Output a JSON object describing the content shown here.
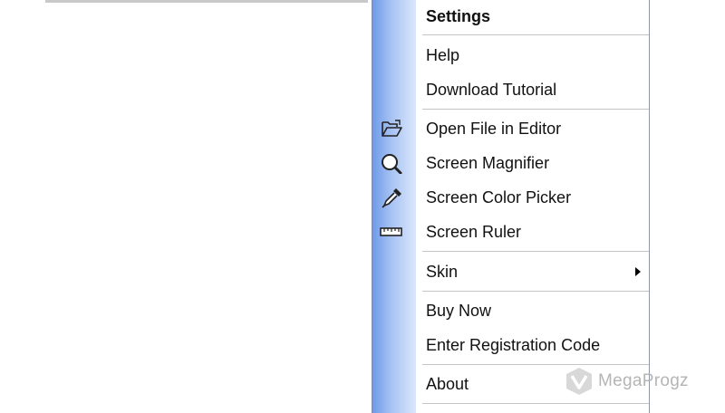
{
  "menu": {
    "items": [
      {
        "label": "Settings",
        "icon": null,
        "bold": true
      },
      {
        "label": "Help",
        "icon": null
      },
      {
        "label": "Download Tutorial",
        "icon": null
      },
      {
        "label": "Open File in Editor",
        "icon": "open-folder-icon"
      },
      {
        "label": "Screen Magnifier",
        "icon": "magnifier-icon"
      },
      {
        "label": "Screen Color Picker",
        "icon": "eyedropper-icon"
      },
      {
        "label": "Screen Ruler",
        "icon": "ruler-icon"
      },
      {
        "label": "Skin",
        "icon": null,
        "submenu": true
      },
      {
        "label": "Buy Now",
        "icon": null
      },
      {
        "label": "Enter Registration Code",
        "icon": null
      },
      {
        "label": "About",
        "icon": null
      }
    ]
  },
  "watermark": {
    "text": "MegaProgz",
    "logo": "megaprogz-logo"
  },
  "colors": {
    "icon_strip": "#a9c4f3",
    "separator": "#c4c4c4",
    "text": "#111111"
  }
}
